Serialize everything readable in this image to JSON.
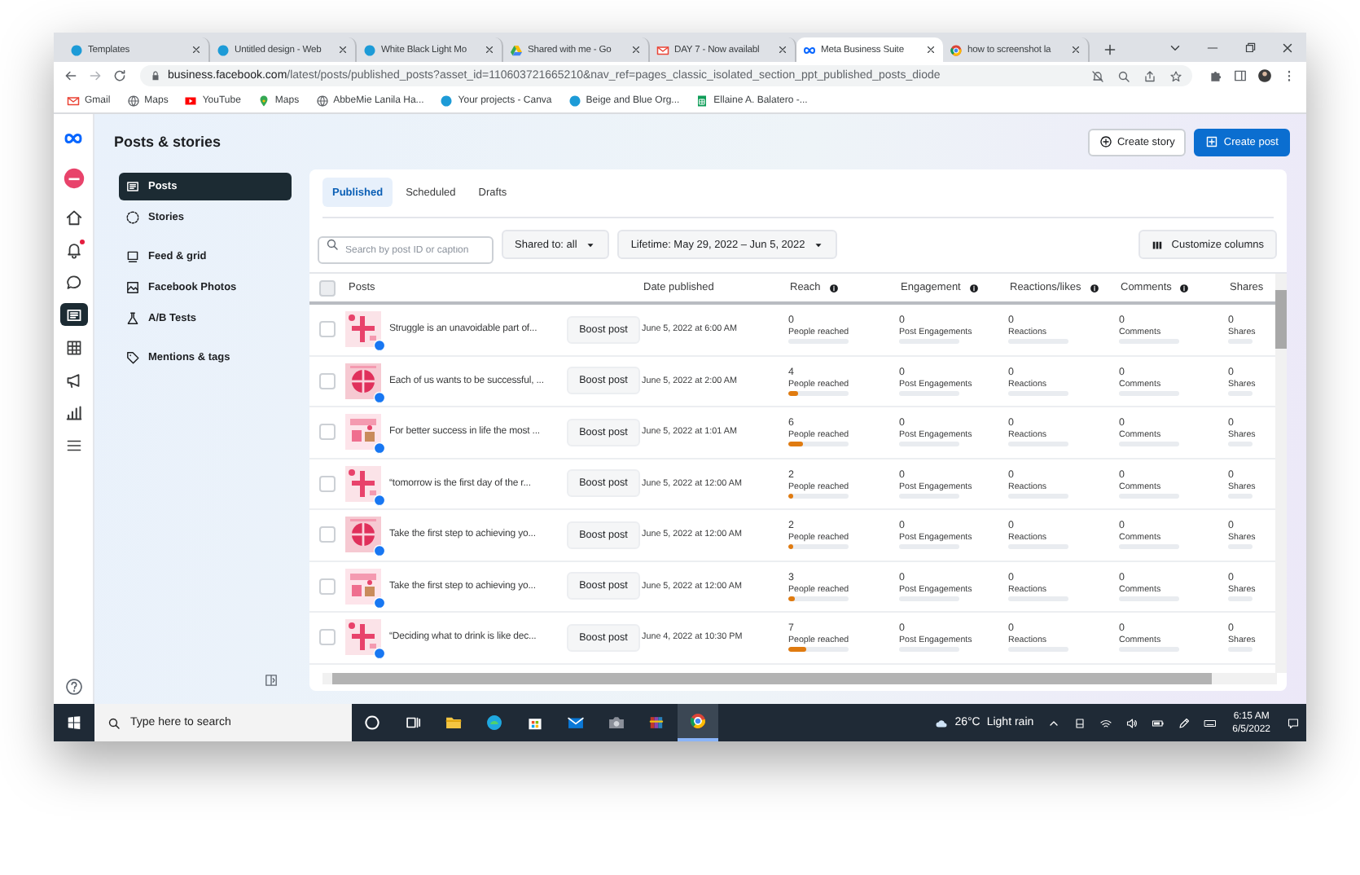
{
  "browser": {
    "tabs": [
      {
        "title": "Templates",
        "selected": false
      },
      {
        "title": "Untitled design - Web",
        "selected": false
      },
      {
        "title": "White Black Light Mo",
        "selected": false
      },
      {
        "title": "Shared with me - Go",
        "selected": false
      },
      {
        "title": "DAY 7 - Now availabl",
        "selected": false
      },
      {
        "title": "Meta Business Suite",
        "selected": true
      },
      {
        "title": "how to screenshot la",
        "selected": false
      }
    ],
    "address": {
      "host": "business.facebook.com",
      "path": "/latest/posts/published_posts?asset_id=110603721665210&nav_ref=pages_classic_isolated_section_ppt_published_posts_diode"
    },
    "bookmarks": [
      {
        "label": "Gmail"
      },
      {
        "label": "Maps"
      },
      {
        "label": "YouTube"
      },
      {
        "label": "Maps"
      },
      {
        "label": "AbbeMie Lanila Ha..."
      },
      {
        "label": "Your projects - Canva"
      },
      {
        "label": "Beige and Blue Org..."
      },
      {
        "label": "Ellaine A. Balatero -..."
      }
    ]
  },
  "rail": [
    {
      "selected": false,
      "badge": false
    },
    {
      "selected": false,
      "badge": true
    },
    {
      "selected": false,
      "badge": false
    },
    {
      "selected": true,
      "badge": false
    },
    {
      "selected": false,
      "badge": false
    },
    {
      "selected": false,
      "badge": false
    },
    {
      "selected": false,
      "badge": false
    },
    {
      "selected": false,
      "badge": false
    }
  ],
  "page": {
    "title": "Posts & stories",
    "actions": [
      {
        "label": "Create story",
        "kind": "secondary"
      },
      {
        "label": "Create post",
        "kind": "primary"
      }
    ]
  },
  "sidebar": {
    "sections": [
      {
        "items": [
          {
            "label": "Posts",
            "selected": true
          },
          {
            "label": "Stories",
            "selected": false
          }
        ]
      },
      {
        "items": [
          {
            "label": "Feed & grid",
            "selected": false
          },
          {
            "label": "Facebook Photos",
            "selected": false
          },
          {
            "label": "A/B Tests",
            "selected": false
          }
        ]
      },
      {
        "items": [
          {
            "label": "Mentions & tags",
            "selected": false
          }
        ]
      }
    ]
  },
  "content_tabs": [
    {
      "label": "Published",
      "selected": true
    },
    {
      "label": "Scheduled",
      "selected": false
    },
    {
      "label": "Drafts",
      "selected": false
    }
  ],
  "filters": {
    "search_placeholder": "Search by post ID or caption",
    "shared": "Shared to: all",
    "range": "Lifetime: May 29, 2022 – Jun 5, 2022",
    "customize": "Customize columns"
  },
  "table": {
    "header_checked": false,
    "columns": [
      {
        "label": "Posts",
        "info": false
      },
      {
        "label": "Date published",
        "info": false
      },
      {
        "label": "Reach",
        "info": true
      },
      {
        "label": "Engagement",
        "info": true
      },
      {
        "label": "Reactions/likes",
        "info": true
      },
      {
        "label": "Comments",
        "info": true
      },
      {
        "label": "Shares",
        "info": false
      }
    ],
    "rows": [
      {
        "checked": false,
        "caption": "Struggle is an unavoidable part of...",
        "button": "Boost post",
        "date": "June 5, 2022 at 6:00 AM",
        "metrics": [
          {
            "value": "0",
            "label": "People reached"
          },
          {
            "value": "0",
            "label": "Post Engagements"
          },
          {
            "value": "0",
            "label": "Reactions"
          },
          {
            "value": "0",
            "label": "Comments"
          },
          {
            "value": "0",
            "label": "Shares"
          }
        ]
      },
      {
        "checked": false,
        "caption": "Each of us wants to be successful, ...",
        "button": "Boost post",
        "date": "June 5, 2022 at 2:00 AM",
        "metrics": [
          {
            "value": "4",
            "label": "People reached",
            "level": 0.16
          },
          {
            "value": "0",
            "label": "Post Engagements"
          },
          {
            "value": "0",
            "label": "Reactions"
          },
          {
            "value": "0",
            "label": "Comments"
          },
          {
            "value": "0",
            "label": "Shares"
          }
        ]
      },
      {
        "checked": false,
        "caption": "For better success in life the most ...",
        "button": "Boost post",
        "date": "June 5, 2022 at 1:01 AM",
        "metrics": [
          {
            "value": "6",
            "label": "People reached",
            "level": 0.25
          },
          {
            "value": "0",
            "label": "Post Engagements"
          },
          {
            "value": "0",
            "label": "Reactions"
          },
          {
            "value": "0",
            "label": "Comments"
          },
          {
            "value": "0",
            "label": "Shares"
          }
        ]
      },
      {
        "checked": false,
        "caption": "“tomorrow is the first day of the r...",
        "button": "Boost post",
        "date": "June 5, 2022 at 12:00 AM",
        "metrics": [
          {
            "value": "2",
            "label": "People reached",
            "level": 0.07
          },
          {
            "value": "0",
            "label": "Post Engagements"
          },
          {
            "value": "0",
            "label": "Reactions"
          },
          {
            "value": "0",
            "label": "Comments"
          },
          {
            "value": "0",
            "label": "Shares"
          }
        ]
      },
      {
        "checked": false,
        "caption": "Take the first step to achieving yo...",
        "button": "Boost post",
        "date": "June 5, 2022 at 12:00 AM",
        "metrics": [
          {
            "value": "2",
            "label": "People reached",
            "level": 0.07
          },
          {
            "value": "0",
            "label": "Post Engagements"
          },
          {
            "value": "0",
            "label": "Reactions"
          },
          {
            "value": "0",
            "label": "Comments"
          },
          {
            "value": "0",
            "label": "Shares"
          }
        ]
      },
      {
        "checked": false,
        "caption": "Take the first step to achieving yo...",
        "button": "Boost post",
        "date": "June 5, 2022 at 12:00 AM",
        "metrics": [
          {
            "value": "3",
            "label": "People reached",
            "level": 0.12
          },
          {
            "value": "0",
            "label": "Post Engagements"
          },
          {
            "value": "0",
            "label": "Reactions"
          },
          {
            "value": "0",
            "label": "Comments"
          },
          {
            "value": "0",
            "label": "Shares"
          }
        ]
      },
      {
        "checked": false,
        "caption": "“Deciding what to drink is like dec...",
        "button": "Boost post",
        "date": "June 4, 2022 at 10:30 PM",
        "metrics": [
          {
            "value": "7",
            "label": "People reached",
            "level": 0.29
          },
          {
            "value": "0",
            "label": "Post Engagements"
          },
          {
            "value": "0",
            "label": "Reactions"
          },
          {
            "value": "0",
            "label": "Comments"
          },
          {
            "value": "0",
            "label": "Shares"
          }
        ]
      }
    ]
  },
  "taskbar": {
    "search_placeholder": "Type here to search",
    "apps": [
      {
        "selected": false
      },
      {
        "selected": false
      },
      {
        "selected": false
      },
      {
        "selected": false
      },
      {
        "selected": false
      },
      {
        "selected": false
      },
      {
        "selected": false
      },
      {
        "selected": false
      },
      {
        "selected": true
      }
    ],
    "temperature": "26°C",
    "weather": "Light rain",
    "time": "6:15 AM",
    "date": "6/5/2022"
  }
}
